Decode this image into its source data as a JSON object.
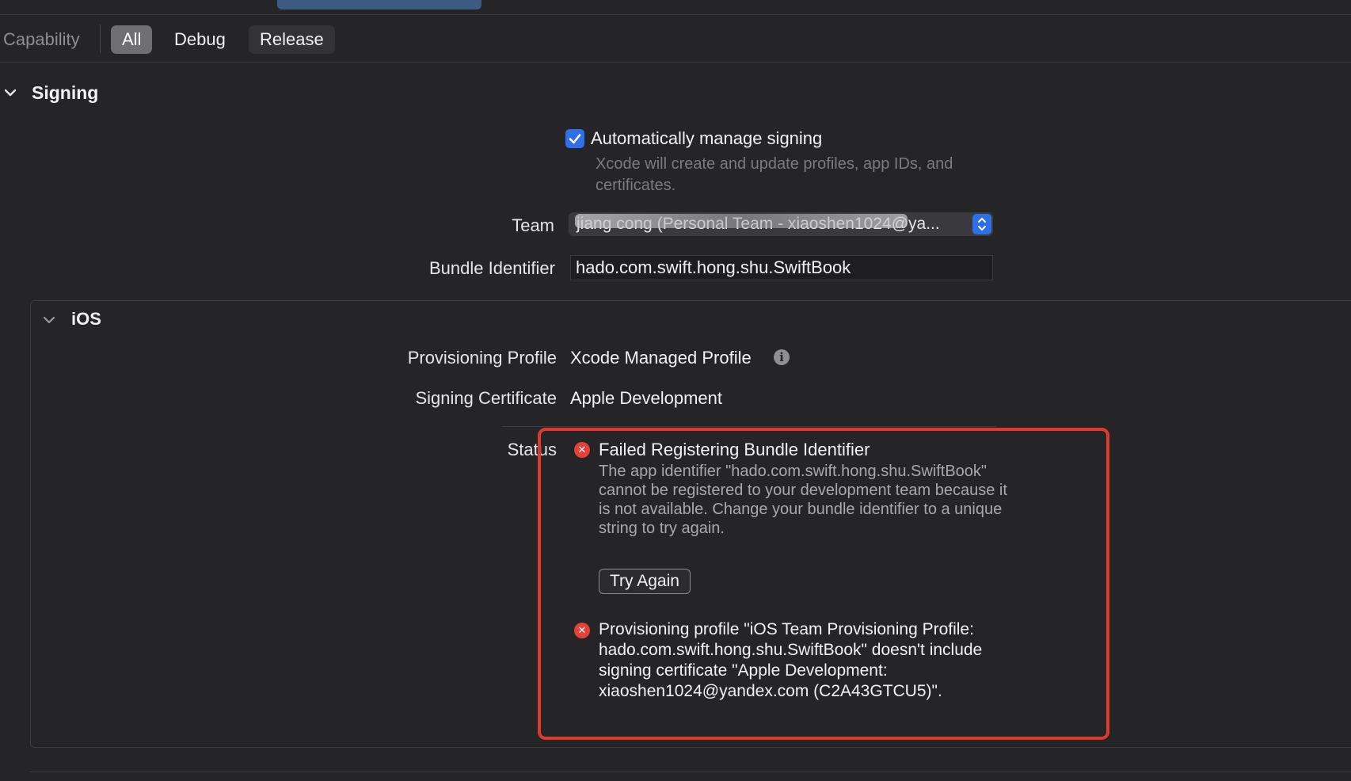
{
  "filter_bar": {
    "capability_label": "Capability",
    "segments": [
      "All",
      "Debug",
      "Release"
    ],
    "selected": "All"
  },
  "signing": {
    "section_title": "Signing",
    "auto_manage": {
      "checked": true,
      "label": "Automatically manage signing",
      "description": "Xcode will create and update profiles, app IDs, and certificates."
    },
    "team": {
      "label": "Team",
      "value": "jiang cong (Personal Team - xiaoshen1024@ya..."
    },
    "bundle_identifier": {
      "label": "Bundle Identifier",
      "value": "hado.com.swift.hong.shu.SwiftBook"
    }
  },
  "ios": {
    "section_title": "iOS",
    "provisioning_profile": {
      "label": "Provisioning Profile",
      "value": "Xcode Managed Profile",
      "info_icon": "i"
    },
    "signing_certificate": {
      "label": "Signing Certificate",
      "value": "Apple Development"
    },
    "status": {
      "label": "Status",
      "errors": [
        {
          "title": "Failed Registering Bundle Identifier",
          "description": "The app identifier \"hado.com.swift.hong.shu.SwiftBook\" cannot be registered to your development team because it is not available. Change your bundle identifier to a unique string to try again.",
          "button": "Try Again"
        },
        {
          "text": "Provisioning profile \"iOS Team Provisioning Profile: hado.com.swift.hong.shu.SwiftBook\" doesn't include signing certificate \"Apple Development: xiaoshen1024@yandex.com (C2A43GTCU5)\"."
        }
      ]
    }
  },
  "colors": {
    "background": "#252528",
    "accent_blue": "#2f6fe8",
    "error_red": "#e5403a",
    "highlight_red": "#e03a2e"
  }
}
